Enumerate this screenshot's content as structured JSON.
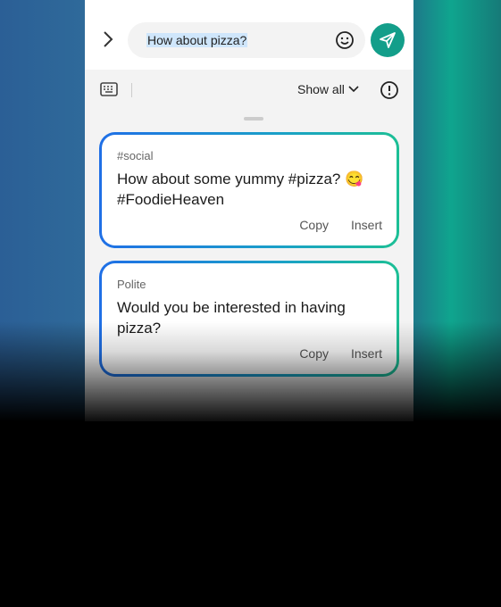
{
  "input": {
    "value": "How about pizza?"
  },
  "toolbar": {
    "show_all_label": "Show all"
  },
  "suggestions": [
    {
      "tag": "#social",
      "text": "How about some yummy #pizza? 😋 #FoodieHeaven",
      "copy": "Copy",
      "insert": "Insert"
    },
    {
      "tag": "Polite",
      "text": "Would you be interested in having pizza?",
      "copy": "Copy",
      "insert": "Insert"
    }
  ],
  "colors": {
    "send_button": "#139e8a",
    "card_gradient_start": "#1f6fe6",
    "card_gradient_end": "#1cbf95",
    "selection": "#cfe6fb"
  },
  "icons": [
    "chevron-right-icon",
    "emoji-icon",
    "send-icon",
    "keyboard-icon",
    "chevron-down-icon",
    "info-icon"
  ]
}
